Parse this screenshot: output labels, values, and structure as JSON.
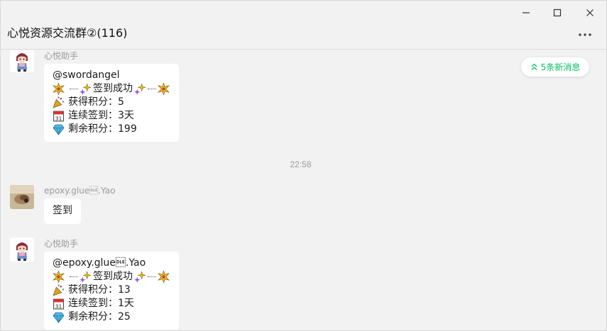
{
  "window": {
    "title": "心悦资源交流群②(116)",
    "controls": [
      "minimize-icon",
      "maximize-icon",
      "close-icon"
    ],
    "more_icon": "more-dots-icon"
  },
  "new_messages_badge": {
    "label": "5条新消息",
    "icon": "double-chevron-up-icon",
    "color": "#07c160"
  },
  "messages": [
    {
      "sender": "心悦助手",
      "avatar": "anime-girl-avatar",
      "mention": "@swordangel",
      "headline": "签到成功",
      "points_label": "获得积分：",
      "points_value": "5",
      "streak_label": "连续签到：",
      "streak_value": "3天",
      "balance_label": "剩余积分：",
      "balance_value": "199"
    },
    {
      "timestamp": "22:58"
    },
    {
      "sender": "epoxy.glue\u0010.Yao",
      "avatar": "photo-avatar",
      "text": "签到"
    },
    {
      "sender": "心悦助手",
      "avatar": "anime-girl-avatar",
      "mention": "@epoxy.glue\u0010.Yao",
      "headline": "签到成功",
      "points_label": "获得积分：",
      "points_value": "13",
      "streak_label": "连续签到：",
      "streak_value": "1天",
      "balance_label": "剩余积分：",
      "balance_value": "25"
    }
  ],
  "colors": {
    "background": "#f2f2f2",
    "bubble": "#ffffff",
    "accent": "#07c160",
    "muted_text": "#9a9a9a"
  }
}
